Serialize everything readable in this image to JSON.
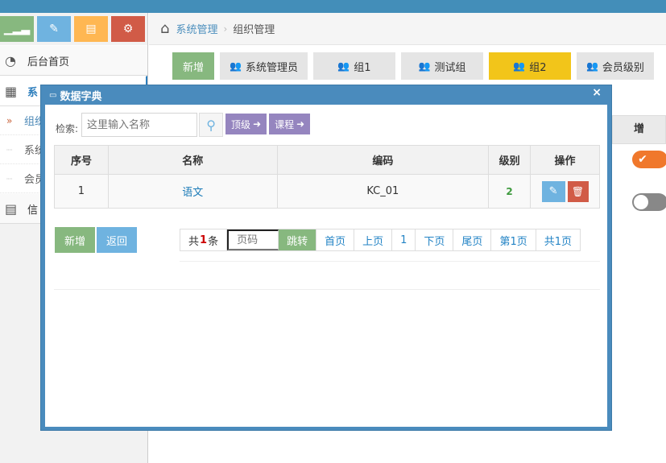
{
  "sidebar": {
    "shortcuts": [
      {
        "icon": "signal-icon",
        "glyph": "▁▂▃"
      },
      {
        "icon": "pencil-icon",
        "glyph": "✎"
      },
      {
        "icon": "book-icon",
        "glyph": "▤"
      },
      {
        "icon": "cogs-icon",
        "glyph": "⚙"
      }
    ],
    "items": [
      {
        "label": "后台首页",
        "icon": "dashboard-icon"
      },
      {
        "label": "系",
        "icon": "film-icon"
      },
      {
        "label": "信",
        "icon": "list-icon"
      }
    ],
    "subitems": [
      {
        "label": "组织"
      },
      {
        "label": "系统"
      },
      {
        "label": "会员"
      }
    ]
  },
  "breadcrumb": {
    "home_icon": "home-icon",
    "parent": "系统管理",
    "current": "组织管理"
  },
  "tabs": {
    "new_label": "新增",
    "items": [
      "系统管理员",
      "组1",
      "测试组",
      "组2",
      "会员级别"
    ]
  },
  "main_table": {
    "partial_header": "增"
  },
  "modal": {
    "title": "数据字典",
    "close": "×",
    "search": {
      "label": "检索:",
      "placeholder": "这里输入名称",
      "level_button": "顶级",
      "course_button": "课程"
    },
    "table": {
      "headers": [
        "序号",
        "名称",
        "编码",
        "级别",
        "操作"
      ],
      "rows": [
        {
          "index": "1",
          "name": "语文",
          "code": "KC_01",
          "level": "2"
        }
      ]
    },
    "buttons": {
      "add": "新增",
      "back": "返回"
    },
    "pager": {
      "total_prefix": "共",
      "total_count": "1",
      "total_suffix": "条",
      "page_placeholder": "页码",
      "jump": "跳转",
      "first": "首页",
      "prev": "上页",
      "page": "1",
      "next": "下页",
      "last": "尾页",
      "current_page": "第1页",
      "total_pages": "共1页"
    }
  }
}
